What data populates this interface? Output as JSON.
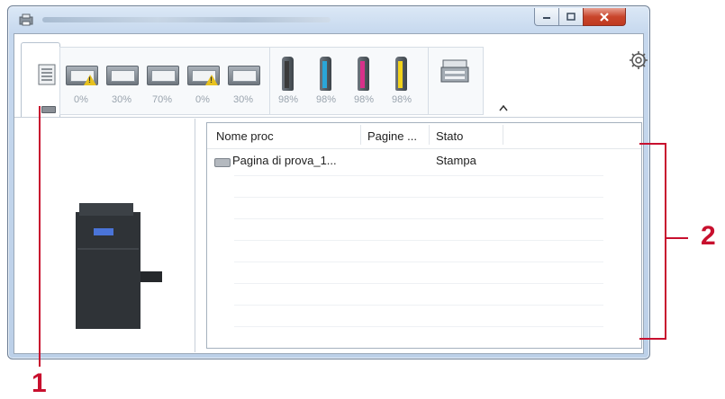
{
  "window": {
    "controls": {
      "minimize": "minimize-icon",
      "maximize": "maximize-icon",
      "close": "close-icon"
    }
  },
  "toolbar": {
    "paper_trays": [
      {
        "level": "0%",
        "warning": true
      },
      {
        "level": "30%",
        "warning": false
      },
      {
        "level": "70%",
        "warning": false
      },
      {
        "level": "0%",
        "warning": true
      },
      {
        "level": "30%",
        "warning": false
      }
    ],
    "toners": [
      {
        "color": "black",
        "hex": "#3a3a3a",
        "level": "98%"
      },
      {
        "color": "cyan",
        "hex": "#2aa6d8",
        "level": "98%"
      },
      {
        "color": "magenta",
        "hex": "#d8318a",
        "level": "98%"
      },
      {
        "color": "yellow",
        "hex": "#f2d21a",
        "level": "98%"
      }
    ],
    "settings_icon": "gear-icon",
    "collapse_icon": "chevron-up-icon"
  },
  "job_list": {
    "columns": [
      "Nome proc",
      "Pagine ...",
      "Stato"
    ],
    "rows": [
      {
        "name": "Pagina di prova_1...",
        "pages": "",
        "status": "Stampa"
      }
    ]
  },
  "callouts": {
    "one": "1",
    "two": "2"
  },
  "colors": {
    "callout": "#c8102e"
  }
}
